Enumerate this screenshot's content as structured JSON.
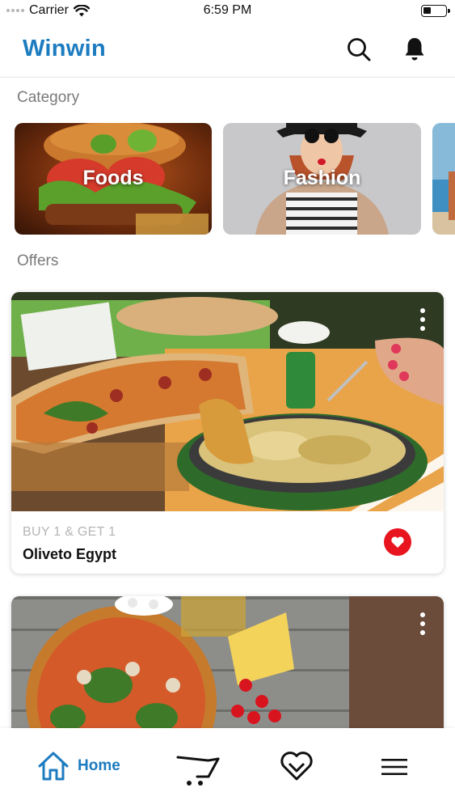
{
  "status_bar": {
    "carrier": "Carrier",
    "time": "6:59 PM"
  },
  "header": {
    "brand": "Winwin",
    "search_icon": "search-icon",
    "bell_icon": "bell-icon"
  },
  "category": {
    "title": "Category",
    "items": [
      {
        "label": "Foods"
      },
      {
        "label": "Fashion"
      }
    ]
  },
  "offers": {
    "title": "Offers",
    "items": [
      {
        "tag": "BUY 1 & GET 1",
        "name": "Oliveto Egypt",
        "favorited": true
      },
      {
        "tag": "",
        "name": ""
      }
    ]
  },
  "tab_bar": {
    "home_label": "Home",
    "icons": [
      "home-icon",
      "cart-icon",
      "heart-icon",
      "menu-icon"
    ]
  },
  "colors": {
    "brand": "#1d7cc0",
    "favorite": "#e8141e",
    "muted": "#7a7a7a"
  }
}
